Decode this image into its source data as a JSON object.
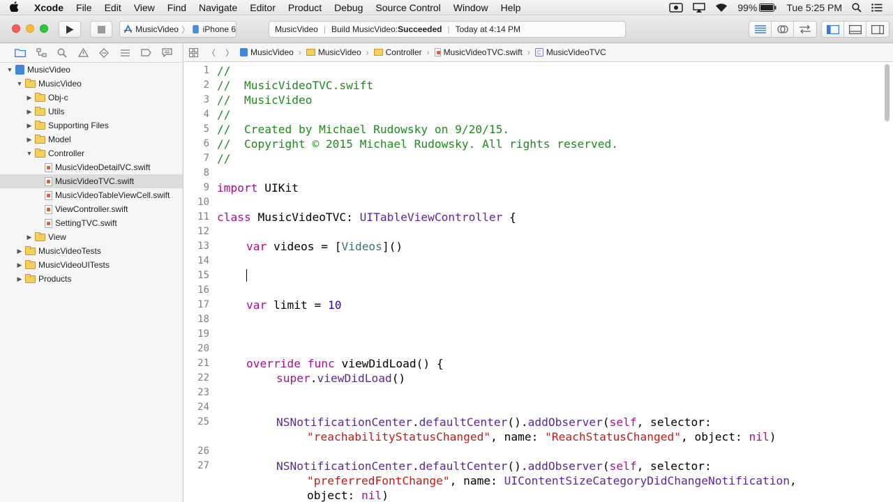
{
  "menubar": {
    "app": "Xcode",
    "items": [
      "File",
      "Edit",
      "View",
      "Find",
      "Navigate",
      "Editor",
      "Product",
      "Debug",
      "Source Control",
      "Window",
      "Help"
    ],
    "battery": "99%",
    "clock": "Tue 5:25 PM"
  },
  "toolbar": {
    "scheme_target": "MusicVideo",
    "scheme_device": "iPhone 6",
    "status_project": "MusicVideo",
    "status_build_prefix": "Build MusicVideo: ",
    "status_build_result": "Succeeded",
    "status_time": "Today at 4:14 PM"
  },
  "navigator": {
    "items": [
      {
        "label": "MusicVideo",
        "kind": "project",
        "level": 0,
        "open": true
      },
      {
        "label": "MusicVideo",
        "kind": "folder",
        "level": 1,
        "open": true
      },
      {
        "label": "Obj-c",
        "kind": "folder",
        "level": 2,
        "open": false
      },
      {
        "label": "Utils",
        "kind": "folder",
        "level": 2,
        "open": false
      },
      {
        "label": "Supporting Files",
        "kind": "folder",
        "level": 2,
        "open": false
      },
      {
        "label": "Model",
        "kind": "folder",
        "level": 2,
        "open": false
      },
      {
        "label": "Controller",
        "kind": "folder",
        "level": 2,
        "open": true
      },
      {
        "label": "MusicVideoDetailVC.swift",
        "kind": "file",
        "level": 3
      },
      {
        "label": "MusicVideoTVC.swift",
        "kind": "file",
        "level": 3,
        "selected": true
      },
      {
        "label": "MusicVideoTableViewCell.swift",
        "kind": "file",
        "level": 3
      },
      {
        "label": "ViewController.swift",
        "kind": "file",
        "level": 3
      },
      {
        "label": "SettingTVC.swift",
        "kind": "file",
        "level": 3
      },
      {
        "label": "View",
        "kind": "folder",
        "level": 2,
        "open": false
      },
      {
        "label": "MusicVideoTests",
        "kind": "folder",
        "level": 1,
        "open": false
      },
      {
        "label": "MusicVideoUITests",
        "kind": "folder",
        "level": 1,
        "open": false
      },
      {
        "label": "Products",
        "kind": "folder",
        "level": 1,
        "open": false
      }
    ]
  },
  "jumpbar": {
    "crumbs": [
      "MusicVideo",
      "MusicVideo",
      "Controller",
      "MusicVideoTVC.swift",
      "MusicVideoTVC"
    ]
  },
  "editor": {
    "line_numbers": [
      "1",
      "2",
      "3",
      "4",
      "5",
      "6",
      "7",
      "8",
      "9",
      "10",
      "11",
      "12",
      "13",
      "14",
      "15",
      "16",
      "17",
      "18",
      "19",
      "20",
      "21",
      "22",
      "23",
      "24",
      "25",
      "26",
      "27"
    ],
    "lines": {
      "l1": "//",
      "l2": "//  MusicVideoTVC.swift",
      "l3": "//  MusicVideo",
      "l4": "//",
      "l5": "//  Created by Michael Rudowsky on 9/20/15.",
      "l6": "//  Copyright © 2015 Michael Rudowsky. All rights reserved.",
      "l7": "//",
      "l9_kw": "import",
      "l9_rest": " UIKit",
      "l11_kw": "class",
      "l11_name": " MusicVideoTVC: ",
      "l11_type": "UITableViewController",
      "l11_rest": " {",
      "l13_kw": "var",
      "l13_a": " videos = [",
      "l13_type": "Videos",
      "l13_b": "]()",
      "l17_kw": "var",
      "l17_a": " limit = ",
      "l17_num": "10",
      "l21_kw": "override func",
      "l21_rest": " viewDidLoad() {",
      "l22_kw": "super",
      "l22_a": ".",
      "l22_fn": "viewDidLoad",
      "l22_b": "()",
      "l25_type": "NSNotificationCenter",
      "l25_a": ".",
      "l25_fn1": "defaultCenter",
      "l25_b": "().",
      "l25_fn2": "addObserver",
      "l25_c": "(",
      "l25_kw": "self",
      "l25_d": ", selector:",
      "l25w_str1": "\"reachabilityStatusChanged\"",
      "l25w_a": ", name: ",
      "l25w_str2": "\"ReachStatusChanged\"",
      "l25w_b": ", object: ",
      "l25w_kw": "nil",
      "l25w_c": ")",
      "l27_type": "NSNotificationCenter",
      "l27_a": ".",
      "l27_fn1": "defaultCenter",
      "l27_b": "().",
      "l27_fn2": "addObserver",
      "l27_c": "(",
      "l27_kw": "self",
      "l27_d": ", selector:",
      "l27w_str1": "\"preferredFontChange\"",
      "l27w_a": ", name: ",
      "l27w_type": "UIContentSizeCategoryDidChangeNotification",
      "l27w_b": ",",
      "l27x_a": "object: ",
      "l27x_kw": "nil",
      "l27x_b": ")"
    }
  }
}
